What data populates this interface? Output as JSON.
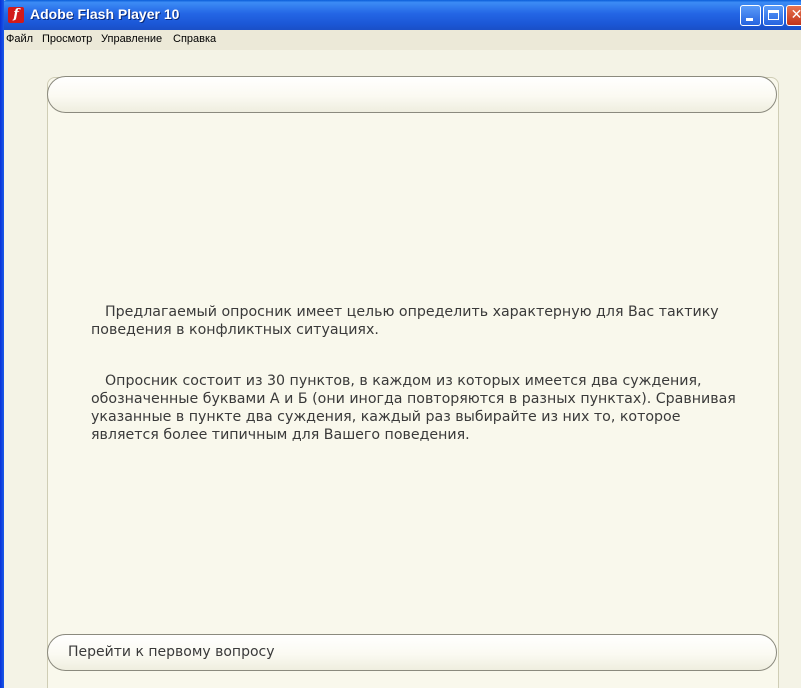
{
  "window": {
    "title": "Adobe Flash Player 10",
    "icon": "flash-player-icon",
    "icon_glyph": "f",
    "controls": {
      "close_glyph": "✕"
    }
  },
  "menubar": {
    "items": [
      {
        "label": "Файл"
      },
      {
        "label": "Просмотр"
      },
      {
        "label": "Управление"
      },
      {
        "label": "Справка"
      }
    ]
  },
  "main": {
    "header_bar": {
      "label": ""
    },
    "paragraphs": [
      "Предлагаемый опросник имеет целью определить характерную для Вас тактику поведения в конфликтных ситуациях.",
      "Опросник состоит из 30 пунктов, в каждом из которых имеется два суждения, обозначенные буквами А и Б (они иногда повторяются в разных пунктах). Сравнивая указанные в пункте два суждения, каждый раз выбирайте из них то, которое является более типичным для Вашего поведения."
    ],
    "next_button": {
      "label": "Перейти к первому вопросу"
    }
  },
  "colors": {
    "titlebar": "#2466e5",
    "background": "#f4f3e6",
    "panel": "#f9f8ec",
    "text": "#3a3a3a"
  }
}
